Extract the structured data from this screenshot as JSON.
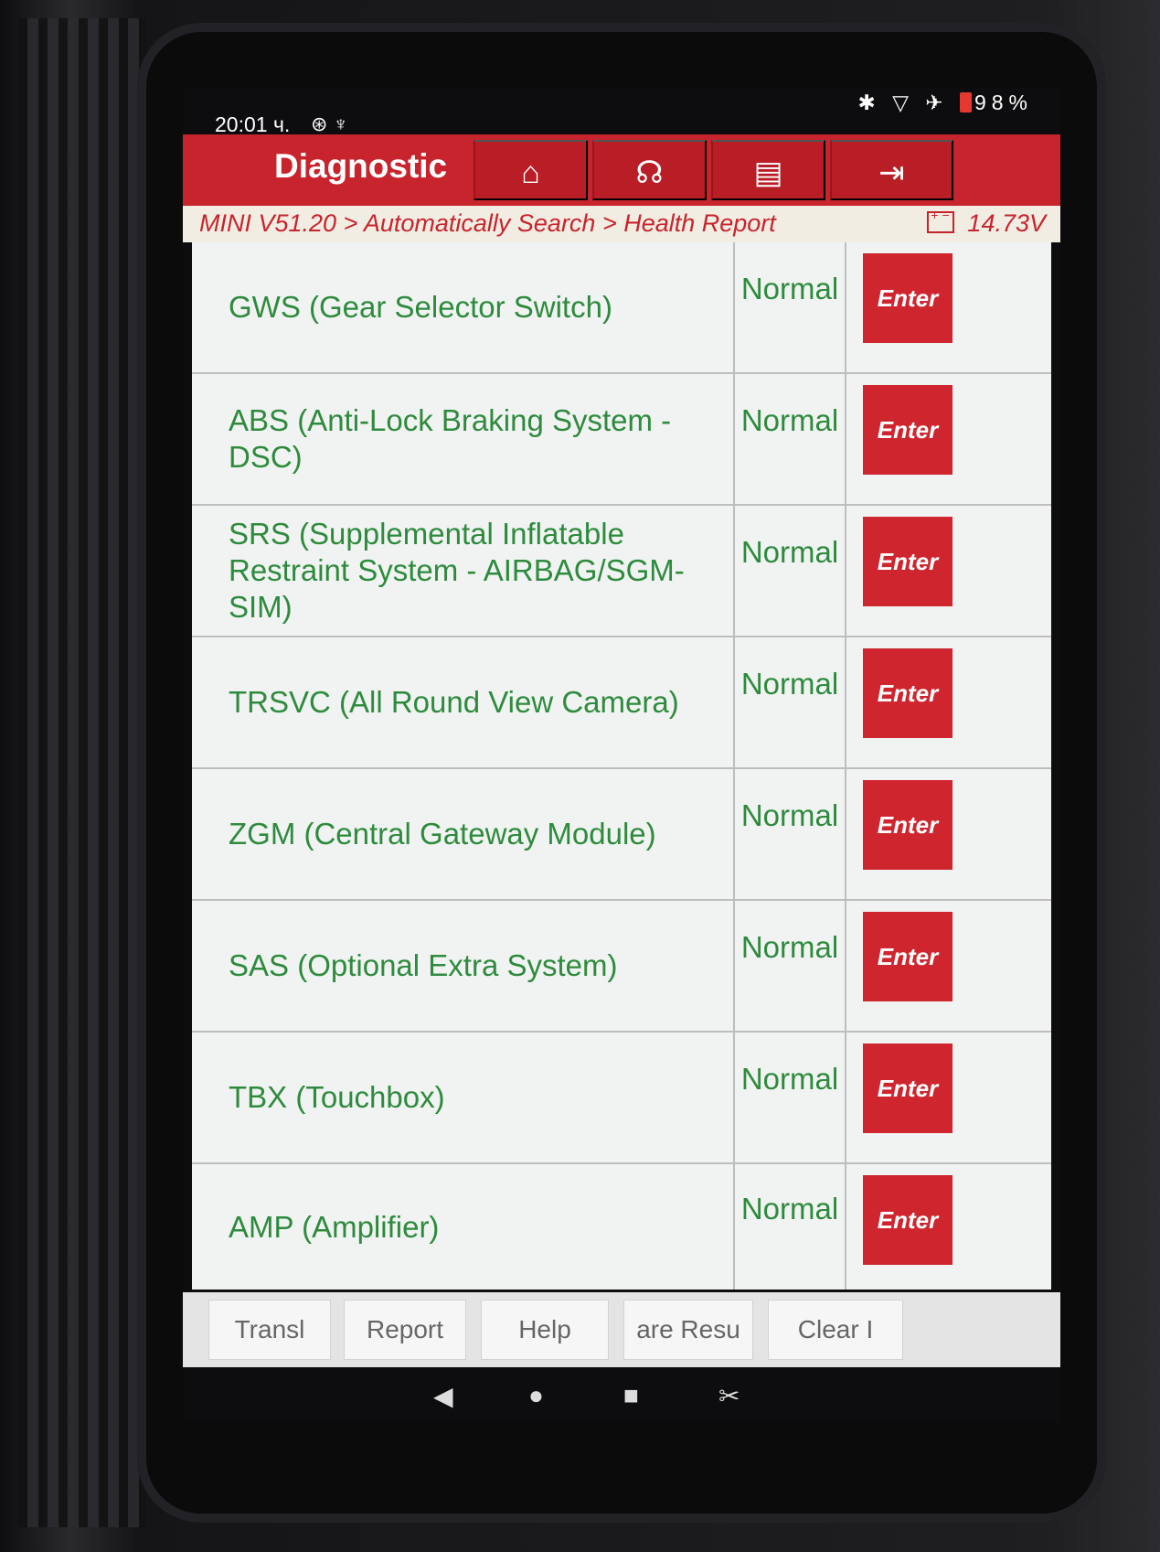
{
  "status_bar": {
    "time": "20:01 ч.",
    "sub_icons": "⊛ ♆",
    "right_icons": "✱ ▽ ✈",
    "battery": "98%"
  },
  "header": {
    "title": "Diagnostic",
    "tools": [
      {
        "name": "home-icon",
        "glyph": "⌂"
      },
      {
        "name": "support-icon",
        "glyph": "☊"
      },
      {
        "name": "print-icon",
        "glyph": "▤"
      },
      {
        "name": "exit-icon",
        "glyph": "⇥"
      }
    ]
  },
  "breadcrumb": {
    "path": "MINI V51.20 > Automatically Search > Health Report",
    "voltage": "14.73V"
  },
  "rows": [
    {
      "name": "GWS (Gear Selector Switch)",
      "status": "Normal",
      "action": "Enter"
    },
    {
      "name": "ABS (Anti-Lock Braking System - DSC)",
      "status": "Normal",
      "action": "Enter"
    },
    {
      "name": "SRS (Supplemental Inflatable Restraint System - AIRBAG/SGM-SIM)",
      "status": "Normal",
      "action": "Enter"
    },
    {
      "name": "TRSVC (All Round View Camera)",
      "status": "Normal",
      "action": "Enter"
    },
    {
      "name": "ZGM (Central Gateway Module)",
      "status": "Normal",
      "action": "Enter"
    },
    {
      "name": "SAS (Optional Extra System)",
      "status": "Normal",
      "action": "Enter"
    },
    {
      "name": "TBX (Touchbox)",
      "status": "Normal",
      "action": "Enter"
    },
    {
      "name": "AMP (Amplifier)",
      "status": "Normal",
      "action": "Enter"
    }
  ],
  "bottom_buttons": [
    "Transl",
    "Report",
    "Help",
    "are Resu",
    "Clear I"
  ],
  "nav": {
    "back": "◀",
    "home": "●",
    "recents": "■",
    "screenshot": "✂"
  },
  "colors": {
    "brand_red": "#c8242d",
    "status_green": "#2e8b3d"
  }
}
